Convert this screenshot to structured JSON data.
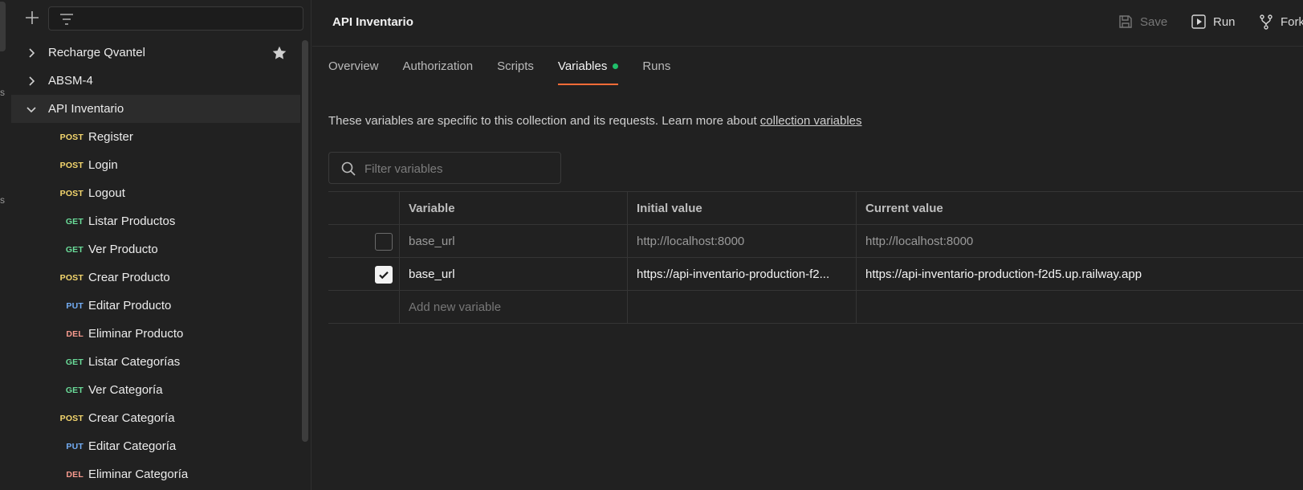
{
  "colors": {
    "accent": "#ff6c37",
    "status_dot": "#1fbf6a",
    "post": "#f5d76e",
    "get": "#6bdd9a",
    "put": "#74aef6",
    "del": "#f79a8e"
  },
  "rail": {
    "frag_1": "s",
    "frag_2": "s"
  },
  "sidebar": {
    "new_icon": "plus-icon",
    "filter_icon": "filter-icon",
    "items": [
      {
        "label": "Recharge Qvantel",
        "icon": "chevron-right-icon",
        "starred": true
      },
      {
        "label": "ABSM-4",
        "icon": "chevron-right-icon"
      },
      {
        "label": "API Inventario",
        "icon": "chevron-down-icon",
        "expanded": true
      }
    ],
    "requests": [
      {
        "method": "POST",
        "name": "Register"
      },
      {
        "method": "POST",
        "name": "Login"
      },
      {
        "method": "POST",
        "name": "Logout"
      },
      {
        "method": "GET",
        "name": "Listar Productos"
      },
      {
        "method": "GET",
        "name": "Ver Producto"
      },
      {
        "method": "POST",
        "name": "Crear Producto"
      },
      {
        "method": "PUT",
        "name": "Editar Producto"
      },
      {
        "method": "DEL",
        "name": "Eliminar Producto"
      },
      {
        "method": "GET",
        "name": "Listar Categorías"
      },
      {
        "method": "GET",
        "name": "Ver Categoría"
      },
      {
        "method": "POST",
        "name": "Crear Categoría"
      },
      {
        "method": "PUT",
        "name": "Editar Categoría"
      },
      {
        "method": "DEL",
        "name": "Eliminar Categoría"
      }
    ]
  },
  "header": {
    "title": "API Inventario",
    "save_label": "Save",
    "run_label": "Run",
    "fork_label": "Fork"
  },
  "tabs": [
    {
      "label": "Overview"
    },
    {
      "label": "Authorization"
    },
    {
      "label": "Scripts"
    },
    {
      "label": "Variables",
      "active": true
    },
    {
      "label": "Runs"
    }
  ],
  "description": {
    "text": "These variables are specific to this collection and its requests. Learn more about ",
    "link": "collection variables"
  },
  "search": {
    "placeholder": "Filter variables",
    "value": ""
  },
  "table": {
    "headers": {
      "variable": "Variable",
      "initial": "Initial value",
      "current": "Current value"
    },
    "rows": [
      {
        "checked": false,
        "variable": "base_url",
        "initial": "http://localhost:8000",
        "current": "http://localhost:8000"
      },
      {
        "checked": true,
        "variable": "base_url",
        "initial": "https://api-inventario-production-f2...",
        "current": "https://api-inventario-production-f2d5.up.railway.app"
      }
    ],
    "add_placeholder": "Add new variable"
  }
}
